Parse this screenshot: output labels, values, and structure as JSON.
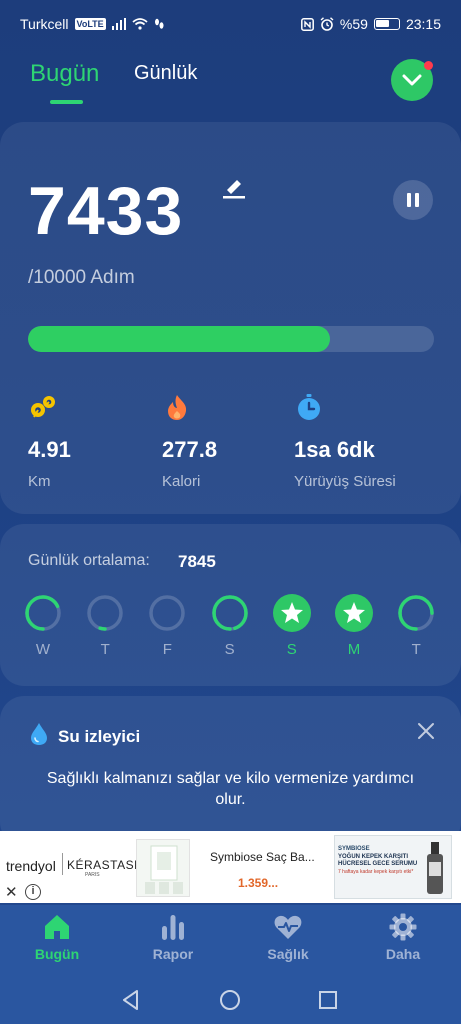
{
  "status_bar": {
    "carrier": "Turkcell",
    "volte": "VoLTE",
    "battery": "%59",
    "time": "23:15"
  },
  "header": {
    "tab_today": "Bugün",
    "tab_daily": "Günlük"
  },
  "steps": {
    "count": "7433",
    "goal_text": "/10000 Adım",
    "progress_fraction": 0.743
  },
  "stats": [
    {
      "value": "4.91",
      "label": "Km",
      "icon": "route-icon",
      "color": "#f5c400"
    },
    {
      "value": "277.8",
      "label": "Kalori",
      "icon": "flame-icon",
      "color": "#ff8a3d"
    },
    {
      "value": "1sa 6dk",
      "label": "Yürüyüş Süresi",
      "icon": "stopwatch-icon",
      "color": "#3fa9f5"
    }
  ],
  "weekly": {
    "avg_label": "Günlük ortalama:",
    "avg_value": "7845",
    "days": [
      {
        "label": "W",
        "progress": 0.68,
        "completed": false,
        "highlight": false
      },
      {
        "label": "T",
        "progress": 0.05,
        "completed": false,
        "highlight": false
      },
      {
        "label": "F",
        "progress": 0.0,
        "completed": false,
        "highlight": false
      },
      {
        "label": "S",
        "progress": 0.95,
        "completed": false,
        "highlight": false
      },
      {
        "label": "S",
        "progress": 1.0,
        "completed": true,
        "highlight": true
      },
      {
        "label": "M",
        "progress": 1.0,
        "completed": true,
        "highlight": true
      },
      {
        "label": "T",
        "progress": 0.75,
        "completed": false,
        "highlight": false
      }
    ]
  },
  "water": {
    "title": "Su izleyici",
    "description": "Sağlıklı kalmanızı sağlar ve kilo vermenize yardımcı olur."
  },
  "ad": {
    "brand_1": "trendyol",
    "brand_2": "KÉRASTASE",
    "brand_2_sub": "PARIS",
    "product_title": "Symbiose Saç Ba...",
    "product_price": "1.359...",
    "banner_line_1": "SYMBIOSE",
    "banner_line_2": "YOĞUN KEPEK KARŞITI",
    "banner_line_3": "HÜCRESEL GECE SERUMU",
    "banner_line_4": "7 haftaya kadar kepek karşıtı etki*"
  },
  "nav": {
    "items": [
      {
        "label": "Bugün",
        "icon": "home-icon",
        "active": true
      },
      {
        "label": "Rapor",
        "icon": "bar-chart-icon",
        "active": false
      },
      {
        "label": "Sağlık",
        "icon": "heart-pulse-icon",
        "active": false
      },
      {
        "label": "Daha",
        "icon": "gear-icon",
        "active": false
      }
    ]
  },
  "colors": {
    "accent_green": "#2ed573",
    "background": "#1d3d7c",
    "nav_background": "#2a56a0"
  }
}
